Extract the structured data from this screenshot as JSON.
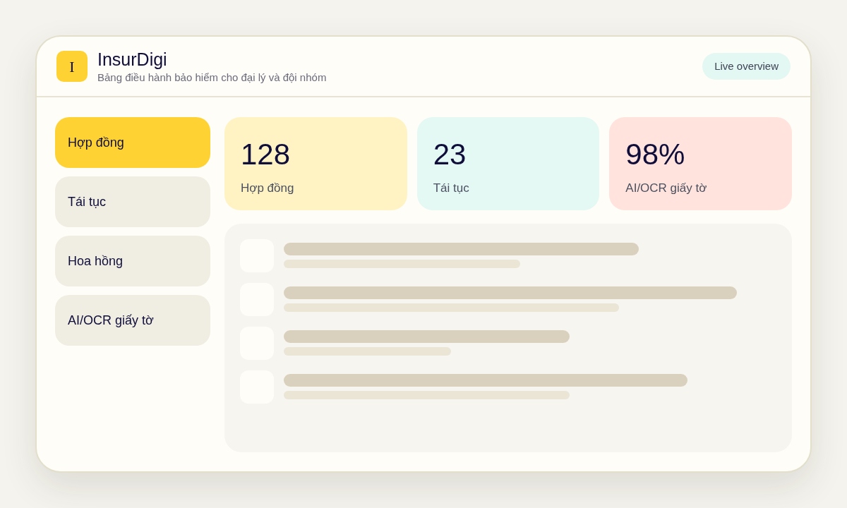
{
  "header": {
    "logo_letter": "I",
    "title": "InsurDigi",
    "subtitle": "Bảng điều hành bảo hiểm cho đại lý và đội nhóm",
    "badge": "Live overview"
  },
  "sidebar": {
    "items": [
      {
        "label": "Hợp đồng",
        "selected": true
      },
      {
        "label": "Tái tục",
        "selected": false
      },
      {
        "label": "Hoa hồng",
        "selected": false
      },
      {
        "label": "AI/OCR giấy tờ",
        "selected": false
      }
    ]
  },
  "stats": [
    {
      "value": "128",
      "label": "Hợp đồng",
      "color": "#fff3c4"
    },
    {
      "value": "23",
      "label": "Tái tục",
      "color": "#e4f8f4"
    },
    {
      "value": "98%",
      "label": "AI/OCR giấy tờ",
      "color": "#ffe3dc"
    }
  ]
}
